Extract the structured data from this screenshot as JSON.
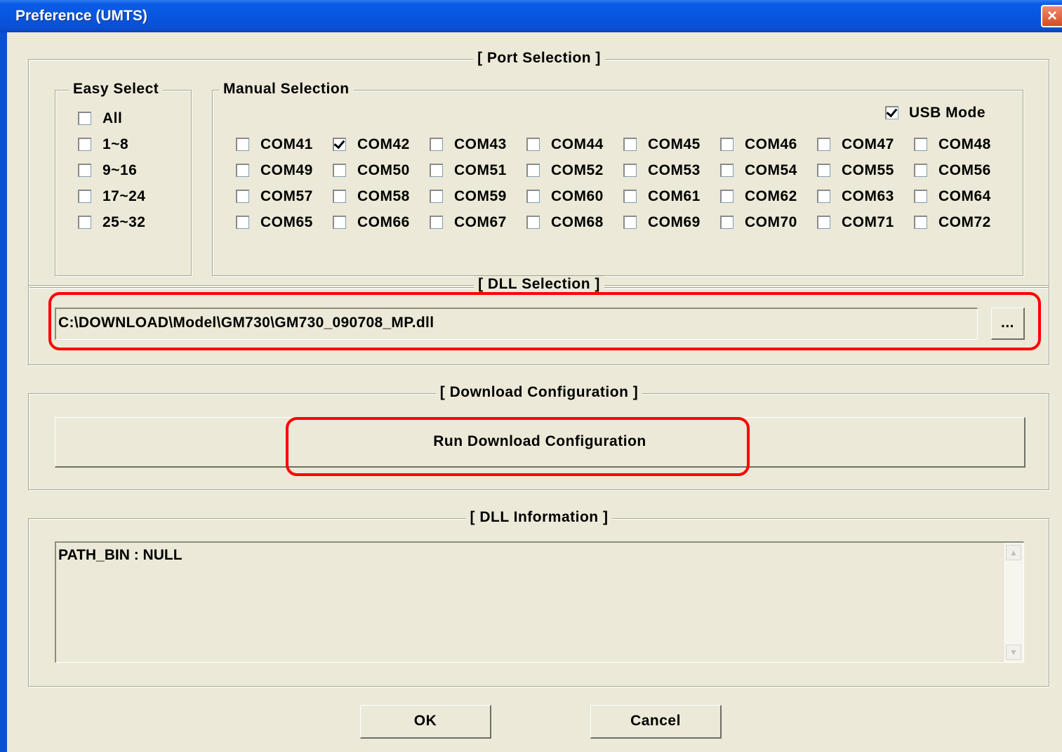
{
  "window": {
    "title": "Preference (UMTS)",
    "close_icon": "×"
  },
  "port_selection": {
    "legend": "[ Port Selection ]",
    "easy_select": {
      "legend": "Easy Select",
      "items": [
        {
          "label": "All",
          "checked": false
        },
        {
          "label": "1~8",
          "checked": false
        },
        {
          "label": "9~16",
          "checked": false
        },
        {
          "label": "17~24",
          "checked": false
        },
        {
          "label": "25~32",
          "checked": false
        }
      ]
    },
    "manual_selection": {
      "legend": "Manual Selection",
      "usb_mode": {
        "label": "USB Mode",
        "checked": true
      },
      "rows": [
        [
          {
            "label": "COM41",
            "checked": false
          },
          {
            "label": "COM42",
            "checked": true
          },
          {
            "label": "COM43",
            "checked": false
          },
          {
            "label": "COM44",
            "checked": false
          },
          {
            "label": "COM45",
            "checked": false
          },
          {
            "label": "COM46",
            "checked": false
          },
          {
            "label": "COM47",
            "checked": false
          },
          {
            "label": "COM48",
            "checked": false
          }
        ],
        [
          {
            "label": "COM49",
            "checked": false
          },
          {
            "label": "COM50",
            "checked": false
          },
          {
            "label": "COM51",
            "checked": false
          },
          {
            "label": "COM52",
            "checked": false
          },
          {
            "label": "COM53",
            "checked": false
          },
          {
            "label": "COM54",
            "checked": false
          },
          {
            "label": "COM55",
            "checked": false
          },
          {
            "label": "COM56",
            "checked": false
          }
        ],
        [
          {
            "label": "COM57",
            "checked": false
          },
          {
            "label": "COM58",
            "checked": false
          },
          {
            "label": "COM59",
            "checked": false
          },
          {
            "label": "COM60",
            "checked": false
          },
          {
            "label": "COM61",
            "checked": false
          },
          {
            "label": "COM62",
            "checked": false
          },
          {
            "label": "COM63",
            "checked": false
          },
          {
            "label": "COM64",
            "checked": false
          }
        ],
        [
          {
            "label": "COM65",
            "checked": false
          },
          {
            "label": "COM66",
            "checked": false
          },
          {
            "label": "COM67",
            "checked": false
          },
          {
            "label": "COM68",
            "checked": false
          },
          {
            "label": "COM69",
            "checked": false
          },
          {
            "label": "COM70",
            "checked": false
          },
          {
            "label": "COM71",
            "checked": false
          },
          {
            "label": "COM72",
            "checked": false
          }
        ]
      ]
    }
  },
  "dll_selection": {
    "legend": "[ DLL Selection ]",
    "path": "C:\\DOWNLOAD\\Model\\GM730\\GM730_090708_MP.dll",
    "browse_label": "..."
  },
  "download_configuration": {
    "legend": "[ Download Configuration ]",
    "run_button": "Run Download Configuration"
  },
  "dll_information": {
    "legend": "[ DLL Information ]",
    "text": "PATH_BIN : NULL"
  },
  "buttons": {
    "ok": "OK",
    "cancel": "Cancel"
  },
  "colors": {
    "title_bar": "#0a5be6",
    "dialog_bg": "#ece9d8",
    "highlight": "#ff0000"
  }
}
